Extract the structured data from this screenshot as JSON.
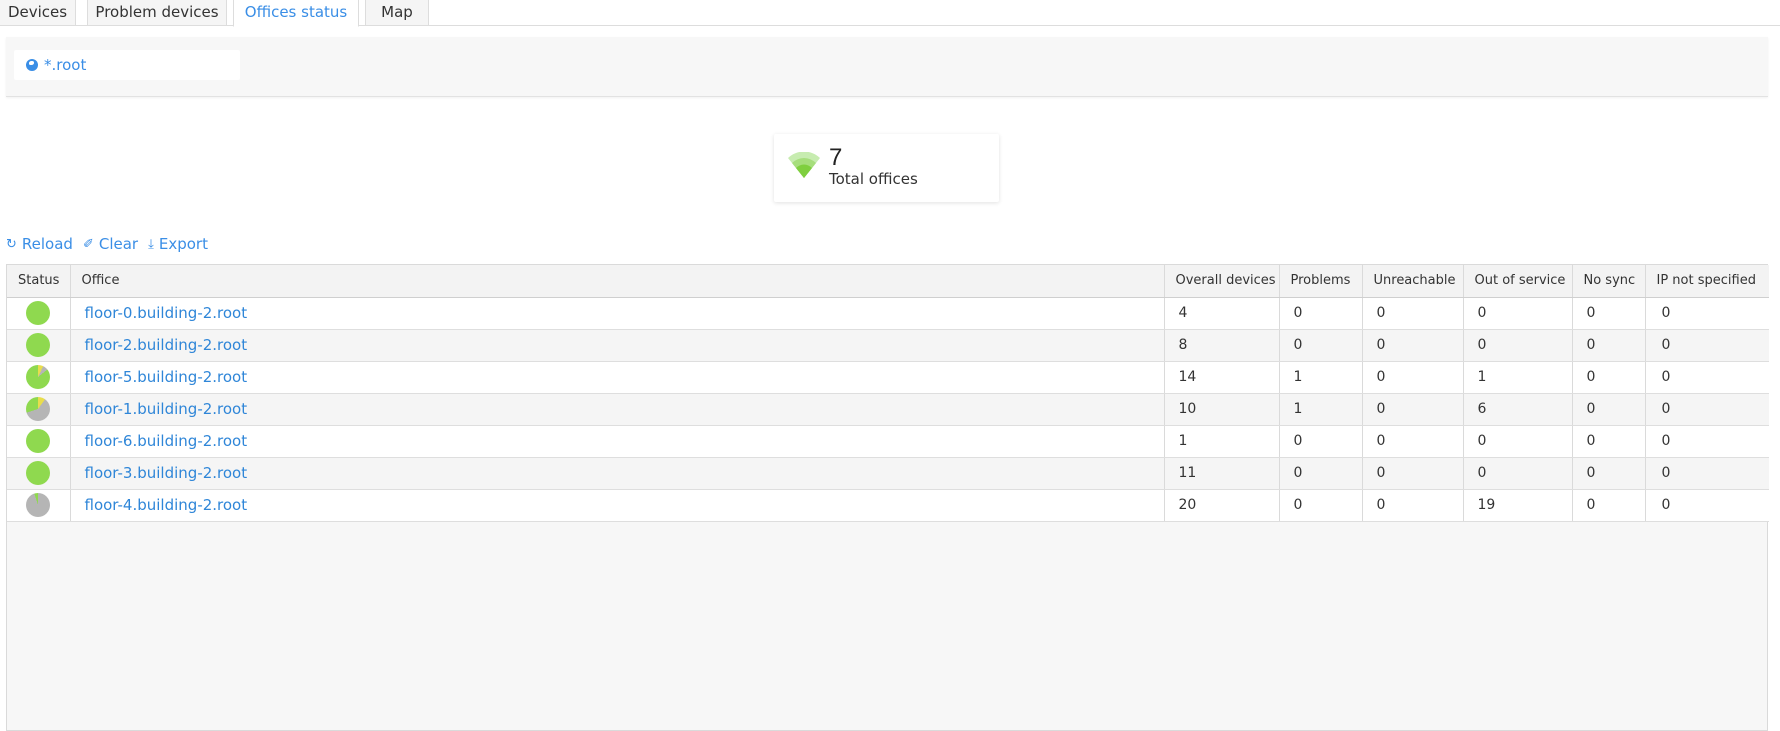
{
  "tabs": [
    {
      "label": "Devices",
      "active": false
    },
    {
      "label": "Problem devices",
      "active": false
    },
    {
      "label": "Offices status",
      "active": true
    },
    {
      "label": "Map",
      "active": false
    }
  ],
  "filter": {
    "icon": "globe-icon",
    "value": "*.root"
  },
  "summary": {
    "icon": "wifi-signal-icon",
    "count": "7",
    "label": "Total offices"
  },
  "toolbar": {
    "reload_label": "Reload",
    "clear_label": "Clear",
    "export_label": "Export"
  },
  "colors": {
    "accent": "#3a8ee6",
    "ok": "#8fd94f",
    "problem": "#e8dd4d",
    "out_of_service": "#b5b5b5"
  },
  "table": {
    "columns": [
      "Status",
      "Office",
      "Overall devices",
      "Problems",
      "Unreachable",
      "Out of service",
      "No sync",
      "IP not specified"
    ],
    "rows": [
      {
        "office": "floor-0.building-2.root",
        "overall": "4",
        "problems": "0",
        "unreachable": "0",
        "out_of_service": "0",
        "no_sync": "0",
        "ip_not_specified": "0"
      },
      {
        "office": "floor-2.building-2.root",
        "overall": "8",
        "problems": "0",
        "unreachable": "0",
        "out_of_service": "0",
        "no_sync": "0",
        "ip_not_specified": "0"
      },
      {
        "office": "floor-5.building-2.root",
        "overall": "14",
        "problems": "1",
        "unreachable": "0",
        "out_of_service": "1",
        "no_sync": "0",
        "ip_not_specified": "0"
      },
      {
        "office": "floor-1.building-2.root",
        "overall": "10",
        "problems": "1",
        "unreachable": "0",
        "out_of_service": "6",
        "no_sync": "0",
        "ip_not_specified": "0"
      },
      {
        "office": "floor-6.building-2.root",
        "overall": "1",
        "problems": "0",
        "unreachable": "0",
        "out_of_service": "0",
        "no_sync": "0",
        "ip_not_specified": "0"
      },
      {
        "office": "floor-3.building-2.root",
        "overall": "11",
        "problems": "0",
        "unreachable": "0",
        "out_of_service": "0",
        "no_sync": "0",
        "ip_not_specified": "0"
      },
      {
        "office": "floor-4.building-2.root",
        "overall": "20",
        "problems": "0",
        "unreachable": "0",
        "out_of_service": "19",
        "no_sync": "0",
        "ip_not_specified": "0"
      }
    ]
  }
}
